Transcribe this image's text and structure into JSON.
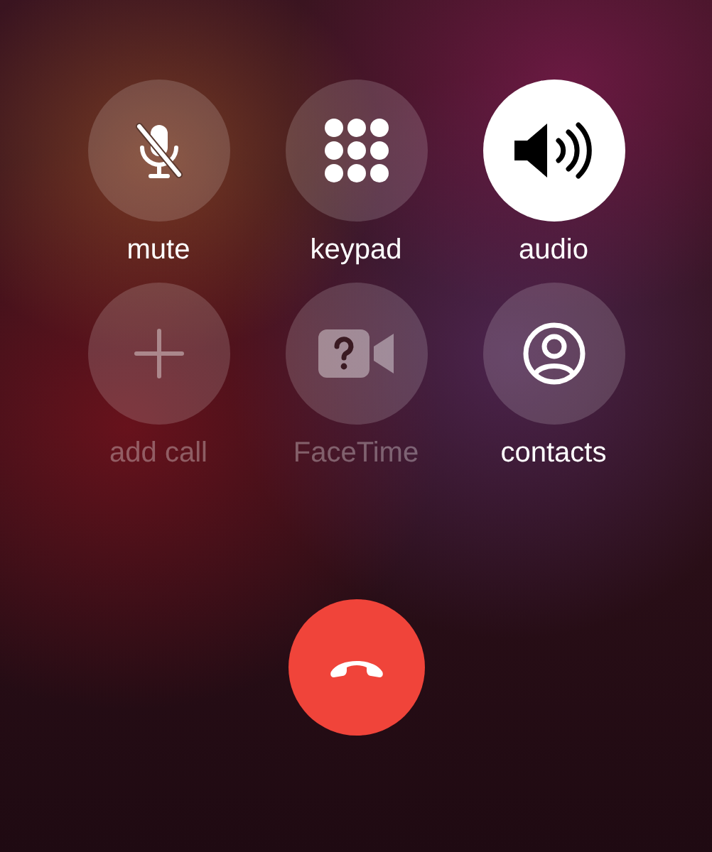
{
  "buttons": [
    {
      "label": "mute",
      "kind": "mute",
      "selected": false,
      "disabled": false
    },
    {
      "label": "keypad",
      "kind": "keypad",
      "selected": false,
      "disabled": false
    },
    {
      "label": "audio",
      "kind": "audio",
      "selected": true,
      "disabled": false
    },
    {
      "label": "add call",
      "kind": "add",
      "selected": false,
      "disabled": true
    },
    {
      "label": "FaceTime",
      "kind": "facetime",
      "selected": false,
      "disabled": true
    },
    {
      "label": "contacts",
      "kind": "contacts",
      "selected": false,
      "disabled": false
    }
  ]
}
